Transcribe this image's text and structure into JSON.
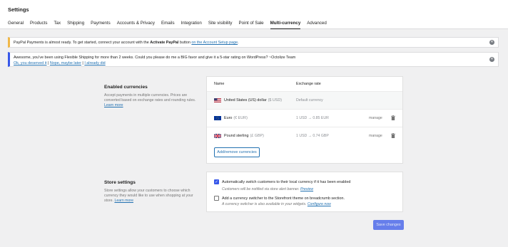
{
  "header": {
    "title": "Settings",
    "tabs": [
      "General",
      "Products",
      "Tax",
      "Shipping",
      "Payments",
      "Accounts & Privacy",
      "Emails",
      "Integration",
      "Site visibility",
      "Point of Sale",
      "Multi-currency",
      "Advanced"
    ],
    "active_tab": "Multi-currency"
  },
  "notices": {
    "paypal": {
      "text_before": "PayPal Payments is almost ready. To get started, connect your account with the ",
      "bold": "Activate PayPal",
      "text_middle": " button ",
      "link": "on the Account Setup page",
      "text_after": "."
    },
    "rating": {
      "text": "Awesome, you've been using Flexible Shipping for more than 2 weeks. Could you please do me a BIG favor and give it a 5-star rating on WordPress? ~Octolize Team",
      "links": [
        "Ok, you deserved it",
        "Nope, maybe later",
        "I already did"
      ],
      "separator": " | "
    }
  },
  "enabled_currencies": {
    "title": "Enabled currencies",
    "description": "Accept payments in multiple currencies. Prices are converted based on exchange rates and rounding rules.",
    "learn_more": "Learn more",
    "col_name": "Name",
    "col_rate": "Exchange rate",
    "currencies": [
      {
        "flag": "us-flag-icon",
        "name": "United States (US) dollar",
        "code": "($ USD)",
        "rate": "Default currency",
        "manage": ""
      },
      {
        "flag": "eu-flag-icon",
        "name": "Euro",
        "code": "(€ EUR)",
        "rate": "1 USD → 0.85 EUR",
        "manage": "manage"
      },
      {
        "flag": "gb-flag-icon",
        "name": "Pound sterling",
        "code": "(£ GBP)",
        "rate": "1 USD → 0.74 GBP",
        "manage": "manage"
      }
    ],
    "add_button": "Add/remove currencies"
  },
  "store_settings": {
    "title": "Store settings",
    "description": "Store settings allow your customers to choose which currency they would like to use when shopping at your store.",
    "learn_more": "Learn more",
    "option1": {
      "checked": true,
      "label": "Automatically switch customers to their local currency if it has been enabled",
      "help": "Customers will be notified via store alert banner.",
      "help_link": "Preview"
    },
    "option2": {
      "checked": false,
      "label": "Add a currency switcher to the Storefront theme on breadcrumb section.",
      "help": "A currency switcher is also available in your widgets.",
      "help_link": "Configure now"
    }
  },
  "save_button": "Save changes",
  "colors": {
    "accent": "#3858e9",
    "link": "#2271b1",
    "warning": "#f0b849"
  }
}
